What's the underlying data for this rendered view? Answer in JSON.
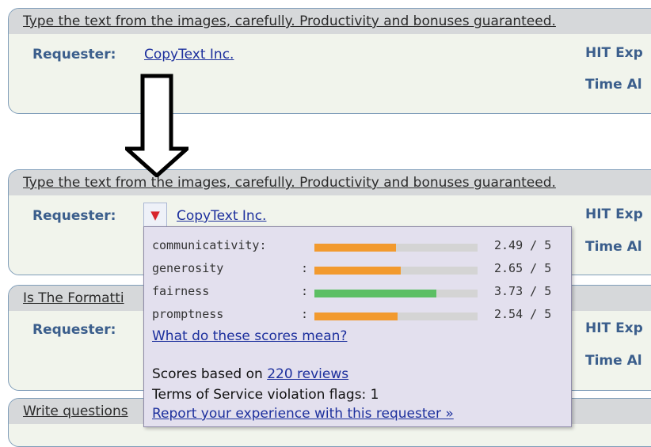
{
  "hits": [
    {
      "title": "Type the text from the images, carefully. Productivity and bonuses guaranteed.",
      "requester_label": "Requester:",
      "requester_name": "CopyText Inc.",
      "expiration_label": "HIT Exp",
      "time_label": "Time Al"
    },
    {
      "title": "Type the text from the images, carefully. Productivity and bonuses guaranteed.",
      "requester_label": "Requester:",
      "requester_name": "CopyText Inc.",
      "expiration_label": "HIT Exp",
      "time_label": "Time Al"
    },
    {
      "title": "Is The Formatti",
      "requester_label": "Requester:",
      "expiration_label": "HIT Exp",
      "time_label": "Time Al"
    },
    {
      "title": "Write questions"
    }
  ],
  "dropdown_icon": "triangle-down-icon",
  "popup": {
    "scores": [
      {
        "label": "communicativity:",
        "colon": "",
        "value": 2.49,
        "max": 5,
        "value_text": "2.49 / 5",
        "color": "#f29a2e"
      },
      {
        "label": "generosity",
        "colon": ":",
        "value": 2.65,
        "max": 5,
        "value_text": "2.65 / 5",
        "color": "#f29a2e"
      },
      {
        "label": "fairness",
        "colon": ":",
        "value": 3.73,
        "max": 5,
        "value_text": "3.73 / 5",
        "color": "#5cbf64"
      },
      {
        "label": "promptness",
        "colon": ":",
        "value": 2.54,
        "max": 5,
        "value_text": "2.54 / 5",
        "color": "#f29a2e"
      }
    ],
    "explain_link": "What do these scores mean?",
    "reviews_prefix": "Scores based on ",
    "reviews_link": "220 reviews",
    "tos_text": "Terms of Service violation flags: 1",
    "report_link": "Report your experience with this requester »"
  }
}
